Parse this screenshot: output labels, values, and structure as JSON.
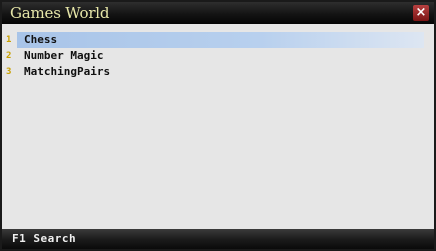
{
  "window": {
    "title": "Games World",
    "close_glyph": "×",
    "close_icon": "close-icon"
  },
  "menu": {
    "items": [
      {
        "index": "1",
        "label": "Chess",
        "selected": true
      },
      {
        "index": "2",
        "label": "Number Magic",
        "selected": false
      },
      {
        "index": "3",
        "label": "MatchingPairs",
        "selected": false
      }
    ]
  },
  "softkeys": {
    "left_label": "F1 Search"
  },
  "colors": {
    "titlebar": "#141414",
    "title_text": "#e6e6a8",
    "selection": "#a8c4e8",
    "index_text": "#c8a000",
    "background": "#e6e6e6"
  }
}
